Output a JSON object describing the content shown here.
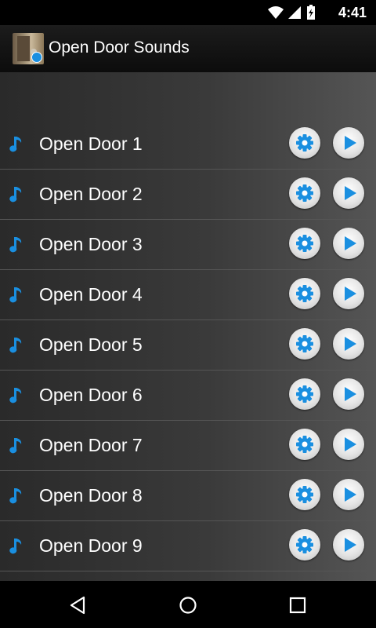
{
  "status_bar": {
    "time": "4:41",
    "icons": [
      "wifi-icon",
      "signal-icon",
      "battery-charging-icon"
    ]
  },
  "action_bar": {
    "title": "Open Door Sounds",
    "icon": "app-icon"
  },
  "sounds": [
    {
      "label": "Open Door 1"
    },
    {
      "label": "Open Door 2"
    },
    {
      "label": "Open Door 3"
    },
    {
      "label": "Open Door 4"
    },
    {
      "label": "Open Door 5"
    },
    {
      "label": "Open Door 6"
    },
    {
      "label": "Open Door 7"
    },
    {
      "label": "Open Door 8"
    },
    {
      "label": "Open Door 9"
    }
  ],
  "colors": {
    "accent": "#1a8fe0",
    "note": "#1a8fe0"
  },
  "nav_bar": {
    "buttons": [
      "back-icon",
      "home-icon",
      "recents-icon"
    ]
  }
}
